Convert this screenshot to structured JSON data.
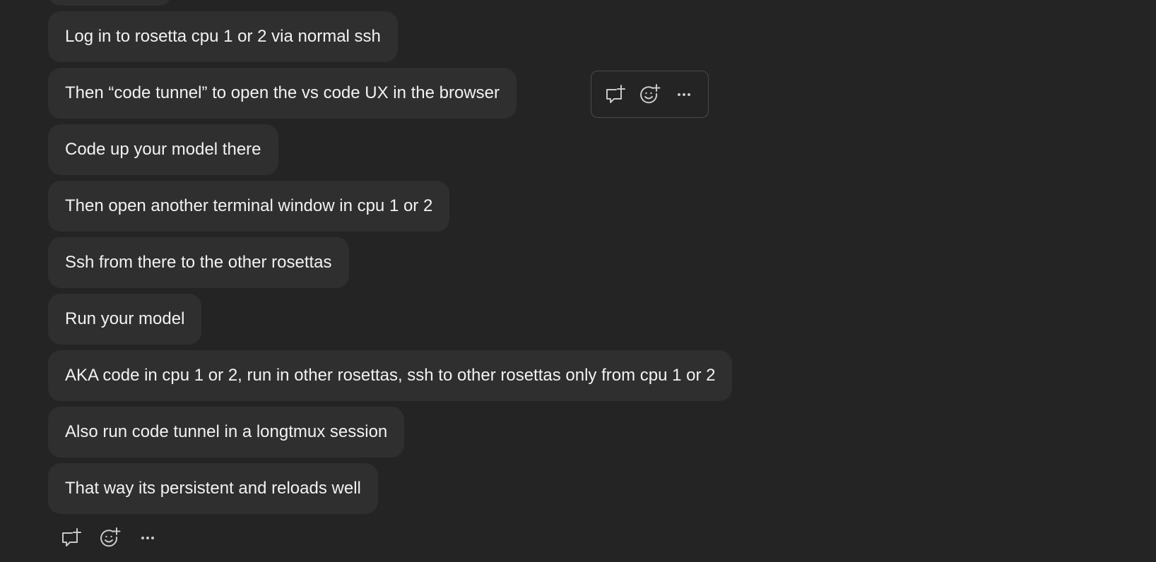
{
  "messages": [
    "Log in to rosetta cpu 1 or 2 via normal ssh",
    "Then “code tunnel” to open the vs code UX in the browser",
    "Code up your model there",
    "Then open another terminal window in cpu 1 or 2",
    "Ssh from there to the other rosettas",
    "Run your model",
    "AKA code in cpu 1 or 2, run in other rosettas, ssh to other rosettas only from cpu 1 or 2",
    "Also run code tunnel in a longtmux session",
    "That way its persistent and reloads well"
  ],
  "hover_toolbar": {
    "icons": [
      "add-comment-icon",
      "add-reaction-icon",
      "more-options-icon"
    ]
  },
  "bottom_actions": {
    "icons": [
      "add-comment-icon",
      "add-reaction-icon",
      "more-options-icon"
    ]
  },
  "colors": {
    "background": "#242424",
    "bubble": "#2f2f30",
    "text": "#f2f2f2",
    "icon": "#c9c9cb",
    "toolbar_border": "#4a4a4c"
  }
}
